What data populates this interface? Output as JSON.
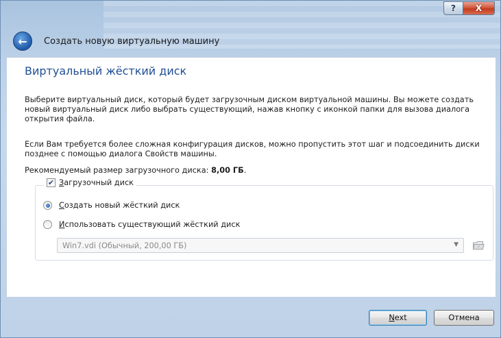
{
  "window": {
    "help_glyph": "?",
    "close_glyph": "X"
  },
  "header": {
    "back_glyph": "←",
    "title": "Создать новую виртуальную машину"
  },
  "page": {
    "heading": "Виртуальный жёсткий диск",
    "paragraph1": "Выберите виртуальный диск, который будет загрузочным диском виртуальной машины. Вы можете создать новый виртуальный диск либо выбрать существующий, нажав кнопку с иконкой папки для вызова диалога открытия файла.",
    "paragraph2": "Если Вам требуется более сложная конфигурация дисков, можно пропустить этот шаг и подсоединить диски позднее с помощью диалога Свойств машины.",
    "recommended_prefix": "Рекомендуемый размер загрузочного диска: ",
    "recommended_size": "8,00 ГБ",
    "recommended_suffix": "."
  },
  "boot_disk": {
    "checkbox_label": "Загрузочный диск",
    "checked": true,
    "check_glyph": "✔",
    "option_create": "Создать новый жёсткий диск",
    "option_existing": "Использовать существующий жёсткий диск",
    "selected_option": "create",
    "existing_disk_value": "Win7.vdi (Обычный, 200,00 ГБ)",
    "dropdown_arrow": "▼"
  },
  "buttons": {
    "next": "Next",
    "cancel": "Отмена"
  },
  "colors": {
    "heading": "#1f4e95",
    "frame": "#bfd2e7",
    "close_button": "#c23b1e"
  }
}
